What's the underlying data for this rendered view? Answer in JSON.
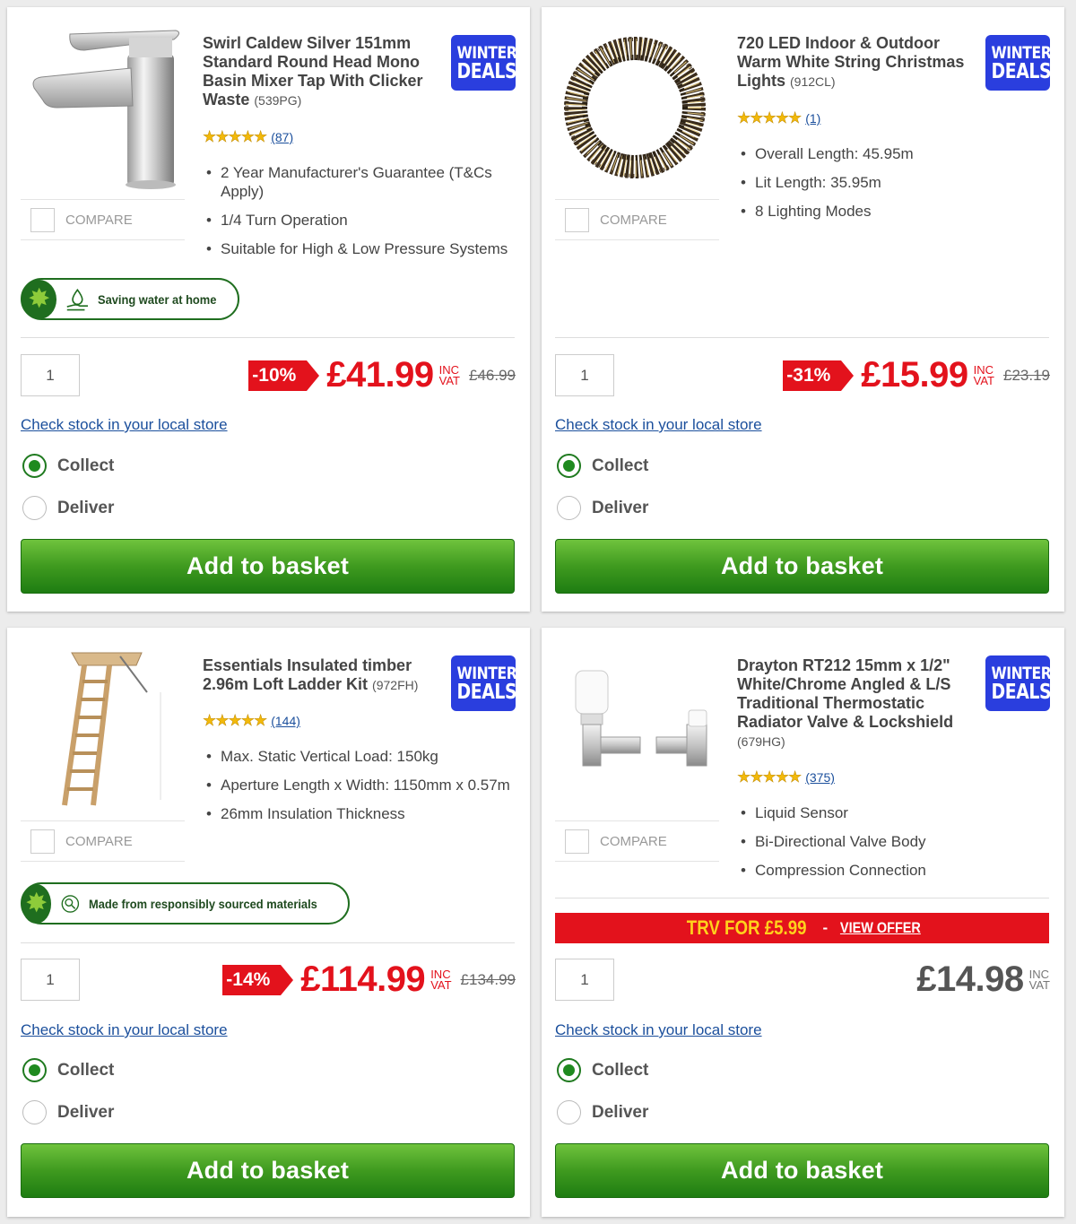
{
  "common": {
    "compare_label": "COMPARE",
    "check_stock": "Check stock in your local store",
    "collect": "Collect",
    "deliver": "Deliver",
    "add_to_basket": "Add to basket",
    "inc": "INC",
    "vat": "VAT",
    "badge_line1": "WINTER",
    "badge_line2": "DEALS"
  },
  "products": [
    {
      "title": "Swirl Caldew Silver 151mm Standard Round Head Mono Basin Mixer Tap With Clicker Waste",
      "code": "(539PG)",
      "stars": "★★★★★",
      "rating_count": "(87)",
      "features": [
        "2 Year Manufacturer's Guarantee (T&Cs Apply)",
        "1/4 Turn Operation",
        "Suitable for High & Low Pressure Systems"
      ],
      "eco_label": "Saving water at home",
      "quantity": "1",
      "discount": "-10%",
      "price": "£41.99",
      "was_price": "£46.99",
      "collect_selected": true
    },
    {
      "title": "720 LED Indoor & Outdoor Warm White String Christmas Lights",
      "code": "(912CL)",
      "stars": "★★★★★",
      "rating_count": "(1)",
      "features": [
        "Overall Length: 45.95m",
        "Lit Length: 35.95m",
        "8 Lighting Modes"
      ],
      "quantity": "1",
      "discount": "-31%",
      "price": "£15.99",
      "was_price": "£23.19",
      "collect_selected": true
    },
    {
      "title": "Essentials Insulated timber 2.96m Loft Ladder Kit",
      "code": "(972FH)",
      "stars": "★★★★★",
      "rating_count": "(144)",
      "features": [
        "Max. Static Vertical Load: 150kg",
        "Aperture Length x Width: 1150mm x 0.57m",
        "26mm Insulation Thickness"
      ],
      "eco_label": "Made from responsibly sourced materials",
      "quantity": "1",
      "discount": "-14%",
      "price": "£114.99",
      "was_price": "£134.99",
      "collect_selected": true
    },
    {
      "title": "Drayton RT212 15mm x 1/2\" White/Chrome Angled & L/S Traditional Thermostatic Radiator Valve & Lockshield",
      "code": "(679HG)",
      "stars": "★★★★★",
      "rating_count": "(375)",
      "features": [
        "Liquid Sensor",
        "Bi-Directional Valve Body",
        "Compression Connection"
      ],
      "offer_text": "TRV FOR £5.99",
      "offer_sep": "-",
      "offer_link": "VIEW OFFER",
      "quantity": "1",
      "price": "£14.98",
      "collect_selected": true
    }
  ],
  "colors": {
    "price_red": "#e3121c",
    "badge_blue": "#2a3ede",
    "button_green": "#3f9a1f",
    "eco_green": "#1f6e1f",
    "link_blue": "#1b4f9c",
    "star_gold": "#f2b90a"
  }
}
